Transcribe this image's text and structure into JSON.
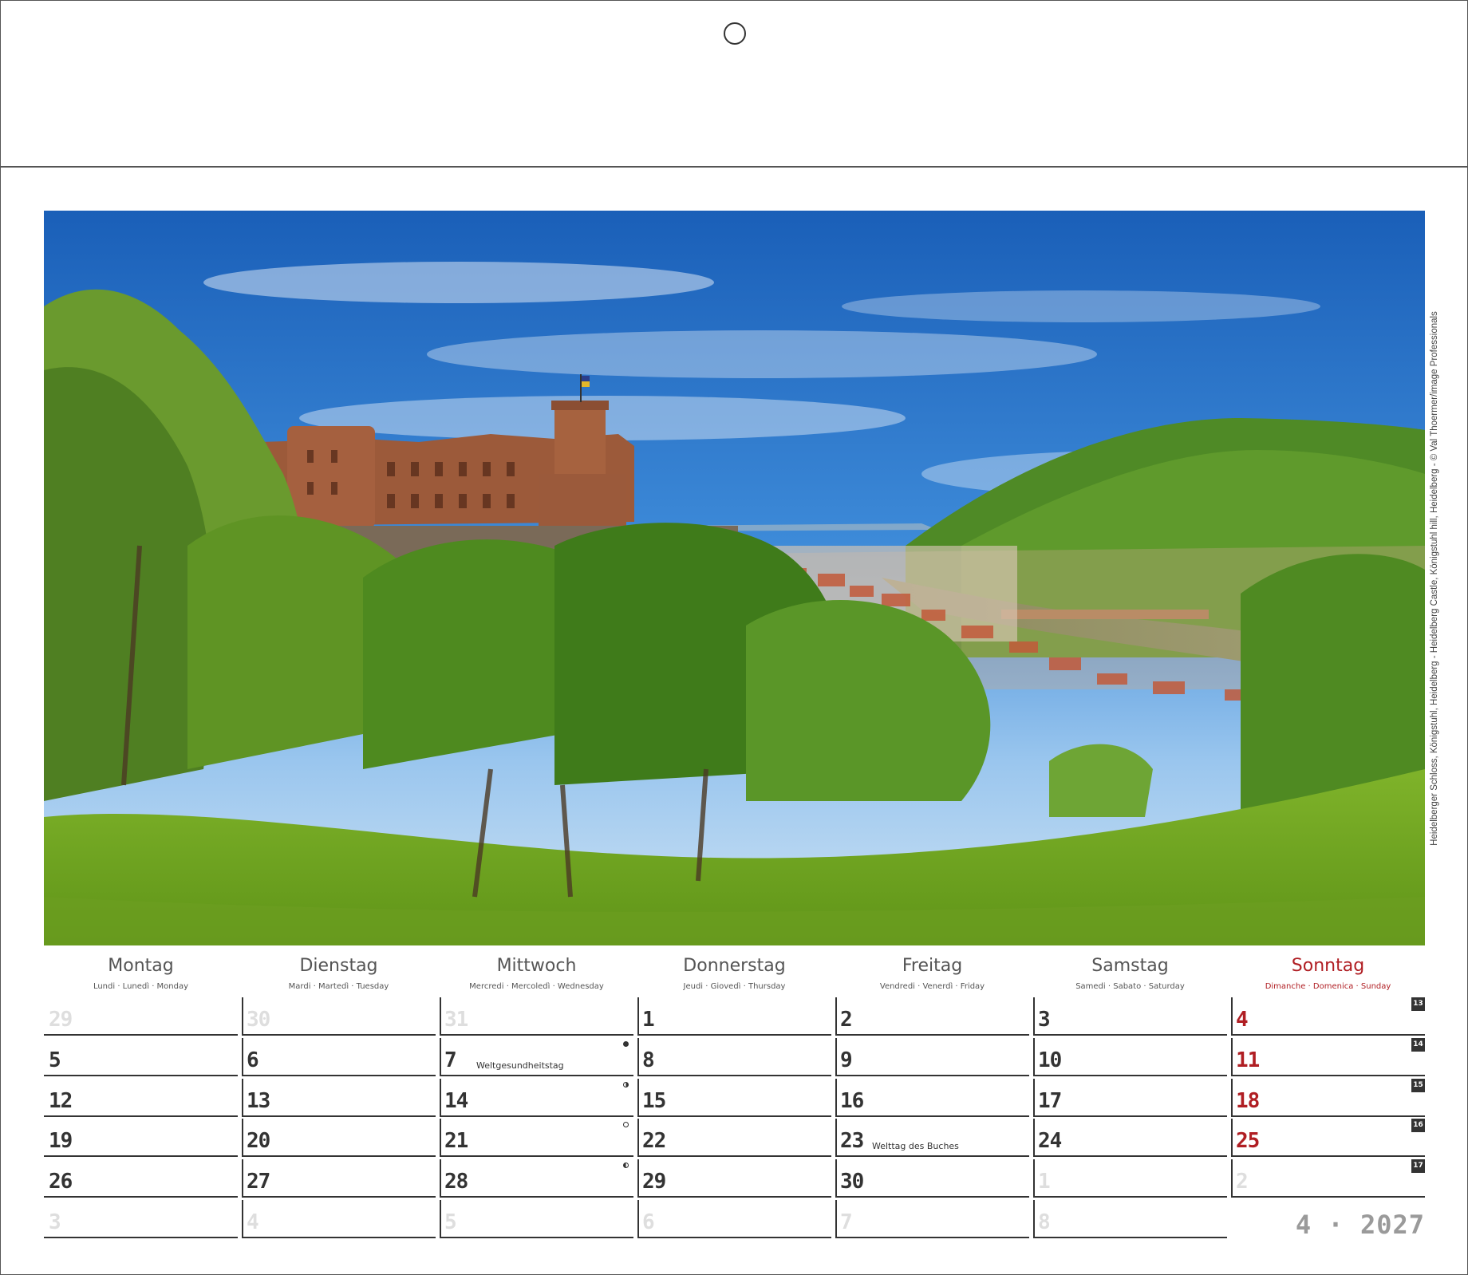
{
  "calendar": {
    "caption": "Heidelberger Schloss, Königstuhl, Heidelberg - Heidelberg Castle, Königstuhl hill, Heidelberg - © Val Thoermer/image Professionals",
    "month_label": "4 · 2027",
    "days": [
      {
        "name": "Montag",
        "sub": "Lundi · Lunedì · Monday"
      },
      {
        "name": "Dienstag",
        "sub": "Mardi · Martedì · Tuesday"
      },
      {
        "name": "Mittwoch",
        "sub": "Mercredi · Mercoledì · Wednesday"
      },
      {
        "name": "Donnerstag",
        "sub": "Jeudi · Giovedì · Thursday"
      },
      {
        "name": "Freitag",
        "sub": "Vendredi · Venerdì · Friday"
      },
      {
        "name": "Samstag",
        "sub": "Samedi · Sabato · Saturday"
      },
      {
        "name": "Sonntag",
        "sub": "Dimanche · Domenica · Sunday"
      }
    ],
    "weeks": [
      {
        "week": "13",
        "cells": [
          {
            "n": "29",
            "o": true
          },
          {
            "n": "30",
            "o": true
          },
          {
            "n": "31",
            "o": true
          },
          {
            "n": "1"
          },
          {
            "n": "2"
          },
          {
            "n": "3"
          },
          {
            "n": "4"
          }
        ]
      },
      {
        "week": "14",
        "cells": [
          {
            "n": "5"
          },
          {
            "n": "6"
          },
          {
            "n": "7",
            "event": "Weltgesundheitstag",
            "moon": "new"
          },
          {
            "n": "8"
          },
          {
            "n": "9"
          },
          {
            "n": "10"
          },
          {
            "n": "11"
          }
        ]
      },
      {
        "week": "15",
        "cells": [
          {
            "n": "12"
          },
          {
            "n": "13"
          },
          {
            "n": "14",
            "moon": "first"
          },
          {
            "n": "15"
          },
          {
            "n": "16"
          },
          {
            "n": "17"
          },
          {
            "n": "18"
          }
        ]
      },
      {
        "week": "16",
        "cells": [
          {
            "n": "19"
          },
          {
            "n": "20"
          },
          {
            "n": "21",
            "moon": "full"
          },
          {
            "n": "22"
          },
          {
            "n": "23",
            "event": "Welttag des Buches"
          },
          {
            "n": "24"
          },
          {
            "n": "25"
          }
        ]
      },
      {
        "week": "17",
        "cells": [
          {
            "n": "26"
          },
          {
            "n": "27"
          },
          {
            "n": "28",
            "moon": "last"
          },
          {
            "n": "29"
          },
          {
            "n": "30"
          },
          {
            "n": "1",
            "o": true
          },
          {
            "n": "2",
            "o": true
          }
        ]
      },
      {
        "cells": [
          {
            "n": "3",
            "o": true
          },
          {
            "n": "4",
            "o": true
          },
          {
            "n": "5",
            "o": true
          },
          {
            "n": "6",
            "o": true
          },
          {
            "n": "7",
            "o": true
          },
          {
            "n": "8",
            "o": true
          }
        ]
      }
    ],
    "colors": {
      "sunday": "#b01e23",
      "ink": "#333333",
      "muted": "#dedede"
    }
  }
}
